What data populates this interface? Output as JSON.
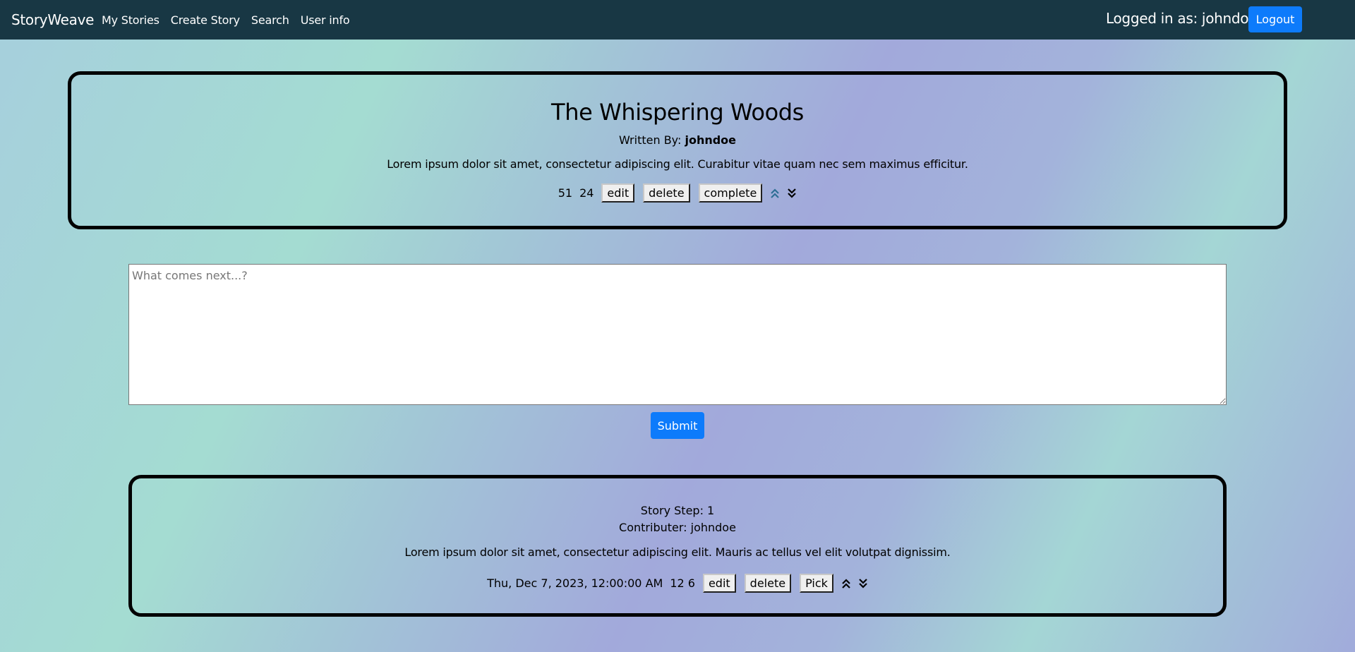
{
  "nav": {
    "brand": "StoryWeave",
    "links": [
      "My Stories",
      "Create Story",
      "Search",
      "User info"
    ],
    "login_text": "Logged in as: johndoe",
    "logout_label": "Logout"
  },
  "story": {
    "title": "The Whispering Woods",
    "written_by_prefix": "Written By:",
    "author": "johndoe",
    "description": "Lorem ipsum dolor sit amet, consectetur adipiscing elit. Curabitur vitae quam nec sem maximus efficitur.",
    "upvotes": "51",
    "downvotes": "24",
    "edit_label": "edit",
    "delete_label": "delete",
    "complete_label": "complete",
    "upvote_icon": "double-chevron-up-icon",
    "downvote_icon": "double-chevron-down-icon",
    "upvote_color": "#2e6f95"
  },
  "composer": {
    "placeholder": "What comes next...?",
    "value": "",
    "submit_label": "Submit"
  },
  "step": {
    "step_label": "Story Step: 1",
    "contributor_label": "Contributer: johndoe",
    "text": "Lorem ipsum dolor sit amet, consectetur adipiscing elit. Mauris ac tellus vel elit volutpat dignissim.",
    "date": "Thu, Dec 7, 2023, 12:00:00 AM",
    "votes": "12 6",
    "edit_label": "edit",
    "delete_label": "delete",
    "pick_label": "Pick"
  },
  "colors": {
    "navbar": "#183744",
    "primary_button": "#0d7bfb"
  }
}
